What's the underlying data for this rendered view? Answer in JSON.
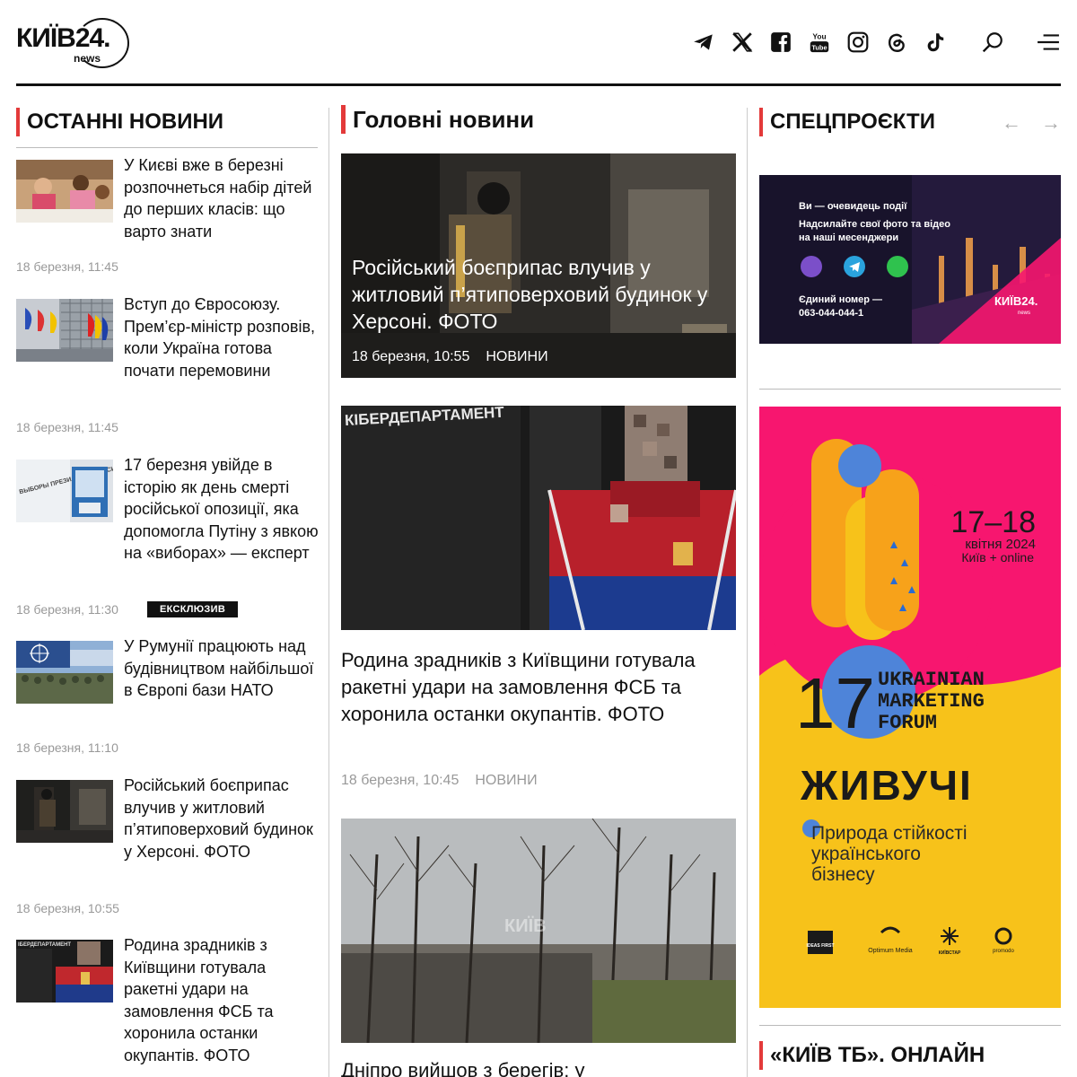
{
  "header": {
    "logo_text": "КИЇВ24.",
    "logo_sub": "news",
    "icons": [
      "telegram-icon",
      "x-icon",
      "facebook-icon",
      "youtube-icon",
      "instagram-icon",
      "threads-icon",
      "tiktok-icon",
      "search-icon",
      "menu-icon"
    ],
    "youtube_top": "You",
    "youtube_bottom": "Tube"
  },
  "left": {
    "heading": "ОСТАННІ НОВИНИ",
    "items": [
      {
        "title": "У Києві вже в березні розпочнеться набір дітей до перших класів: що варто знати",
        "time": "18 березня, 11:45"
      },
      {
        "title": "Вступ до Євросоюзу. Прем’єр-міністр розповів, коли Україна готова почати перемовини",
        "time": "18 березня, 11:45"
      },
      {
        "title": "17 березня увійде в історію як день смерті російської опозиції, яка допомогла Путіну з явкою на «виборах» — експерт",
        "time": "18 березня, 11:30",
        "badge": "ЕКСКЛЮЗИВ"
      },
      {
        "title": "У Румунії працюють над будівництвом найбільшої в Європі бази НАТО",
        "time": "18 березня, 11:10"
      },
      {
        "title": "Російський боєприпас влучив у житловий п’ятиповерховий будинок у Херсоні. ФОТО",
        "time": "18 березня, 10:55"
      },
      {
        "title": "Родина зрадників з Київщини готувала ракетні удари на замовлення ФСБ та хоронила останки окупантів. ФОТО",
        "time": ""
      }
    ],
    "thumb_texts": {
      "elections": "ВЫБОРЫ ПРЕЗИДЕНТА РОССИИ",
      "cyber": "ІБЕРДЕПАРТАМЕНТ"
    }
  },
  "center": {
    "heading": "Головні новини",
    "feature": {
      "title": "Російський боєприпас влучив у житловий п’ятиповерховий будинок у Херсоні. ФОТО",
      "time": "18 березня, 10:55",
      "category": "НОВИНИ"
    },
    "second": {
      "title": "Родина зрадників з Київщини готувала ракетні удари на замовлення ФСБ та хоронила останки окупантів. ФОТО",
      "time": "18 березня, 10:45",
      "category": "НОВИНИ",
      "img_text": "КІБЕРДЕПАРТАМЕНТ"
    },
    "third": {
      "title": "Дніпро вийшов з берегів: у",
      "watermark": "КИЇВ"
    }
  },
  "right": {
    "heading": "СПЕЦПРОЄКТИ",
    "heading2": "«КИЇВ ТБ». ОНЛАЙН",
    "arrow_prev": "←",
    "arrow_next": "→",
    "promo1": {
      "line1": "Ви — очевидець події",
      "line2": "Надсилайте свої фото та відео",
      "line3": "на наші месенджери",
      "line4": "Єдиний номер —",
      "line5": "063-044-044-1",
      "brand": "КИЇВ24.",
      "brand_sub": "news"
    },
    "promo2": {
      "date": "17–18",
      "month": "квітня 2024",
      "place": "Київ + online",
      "num": "17",
      "forum1": "UKRAINIAN",
      "forum2": "MARKETING",
      "forum3": "FORUM",
      "slogan": "ЖИВУЧІ",
      "sub1": "Природа стійкості",
      "sub2": "українського",
      "sub3": "бізнесу",
      "sponsors": [
        "IDEAS FIRST",
        "Optimum Media",
        "КИЇВСТАР",
        "promodo"
      ]
    }
  },
  "colors": {
    "accent": "#e33a3a",
    "promo_pink": "#f7166f",
    "promo_yellow": "#f7c21a"
  }
}
